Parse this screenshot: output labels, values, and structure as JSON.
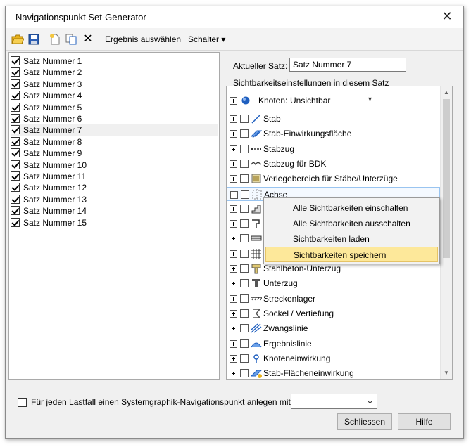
{
  "window": {
    "title": "Navigationspunkt Set-Generator",
    "close_glyph": "✕"
  },
  "toolbar": {
    "icons": [
      "open-folder-icon",
      "save-icon",
      "new-icon",
      "copy-icon",
      "delete-icon"
    ],
    "delete_glyph": "✕",
    "result_label": "Ergebnis auswählen",
    "switch_label": "Schalter ▾"
  },
  "sets": {
    "items": [
      {
        "label": "Satz Nummer 1",
        "checked": true
      },
      {
        "label": "Satz Nummer 2",
        "checked": true
      },
      {
        "label": "Satz Nummer 3",
        "checked": true
      },
      {
        "label": "Satz Nummer 4",
        "checked": true
      },
      {
        "label": "Satz Nummer 5",
        "checked": true
      },
      {
        "label": "Satz Nummer 6",
        "checked": true
      },
      {
        "label": "Satz Nummer 7",
        "checked": true,
        "selected": true
      },
      {
        "label": "Satz Nummer 8",
        "checked": true
      },
      {
        "label": "Satz Nummer 9",
        "checked": true
      },
      {
        "label": "Satz Nummer 10",
        "checked": true
      },
      {
        "label": "Satz Nummer 11",
        "checked": true
      },
      {
        "label": "Satz Nummer 12",
        "checked": true
      },
      {
        "label": "Satz Nummer 13",
        "checked": true
      },
      {
        "label": "Satz Nummer 14",
        "checked": true
      },
      {
        "label": "Satz Nummer 15",
        "checked": true
      }
    ]
  },
  "current_set": {
    "label": "Aktueller Satz:",
    "value": "Satz Nummer 7"
  },
  "visibility": {
    "heading": "Sichtbarkeitseinstellungen in diesem Satz",
    "knoten": {
      "label": "Knoten:",
      "value": "Unsichtbar",
      "arrow": "▾"
    },
    "items": [
      {
        "label": "Stab",
        "icon": "member-icon"
      },
      {
        "label": "Stab-Einwirkungsfläche",
        "icon": "member-load-area-icon"
      },
      {
        "label": "Stabzug",
        "icon": "member-chain-icon"
      },
      {
        "label": "Stabzug für BDK",
        "icon": "member-chain-bdk-icon"
      },
      {
        "label": "Verlegebereich für Stäbe/Unterzüge",
        "icon": "laying-area-icon"
      },
      {
        "label": "Achse",
        "icon": "axis-icon",
        "highlighted": true
      },
      {
        "label": "",
        "icon": "stair-icon"
      },
      {
        "label": "",
        "icon": "support-icon"
      },
      {
        "label": "",
        "icon": "slab-icon"
      },
      {
        "label": "",
        "icon": "grid-icon"
      },
      {
        "label": "Stahlbeton-Unterzug",
        "icon": "rc-beam-icon"
      },
      {
        "label": "Unterzug",
        "icon": "beam-icon"
      },
      {
        "label": "Streckenlager",
        "icon": "line-support-icon"
      },
      {
        "label": "Sockel / Vertiefung",
        "icon": "pedestal-icon"
      },
      {
        "label": "Zwangslinie",
        "icon": "constraint-line-icon"
      },
      {
        "label": "Ergebnislinie",
        "icon": "result-line-icon"
      },
      {
        "label": "Knoteneinwirkung",
        "icon": "node-load-icon"
      },
      {
        "label": "Stab-Flächeneinwirkung",
        "icon": "member-area-load-icon"
      }
    ]
  },
  "context_menu": {
    "items": [
      {
        "label": "Alle Sichtbarkeiten einschalten"
      },
      {
        "label": "Alle Sichtbarkeiten ausschalten"
      },
      {
        "label": "Sichtbarkeiten laden"
      },
      {
        "label": "Sichtbarkeiten speichern",
        "active": true
      }
    ]
  },
  "footer": {
    "checkbox_label": "Für jeden Lastfall einen Systemgraphik-Navigationspunkt anlegen mit Satz:",
    "checked": false,
    "dropdown_value": "",
    "dropdown_arrow": "⌄",
    "close_button": "Schliessen",
    "help_button": "Hilfe"
  },
  "colors": {
    "menu_active": "#fde89a",
    "icon_blue": "#1f5fbf",
    "icon_yellow": "#e8b21b"
  }
}
